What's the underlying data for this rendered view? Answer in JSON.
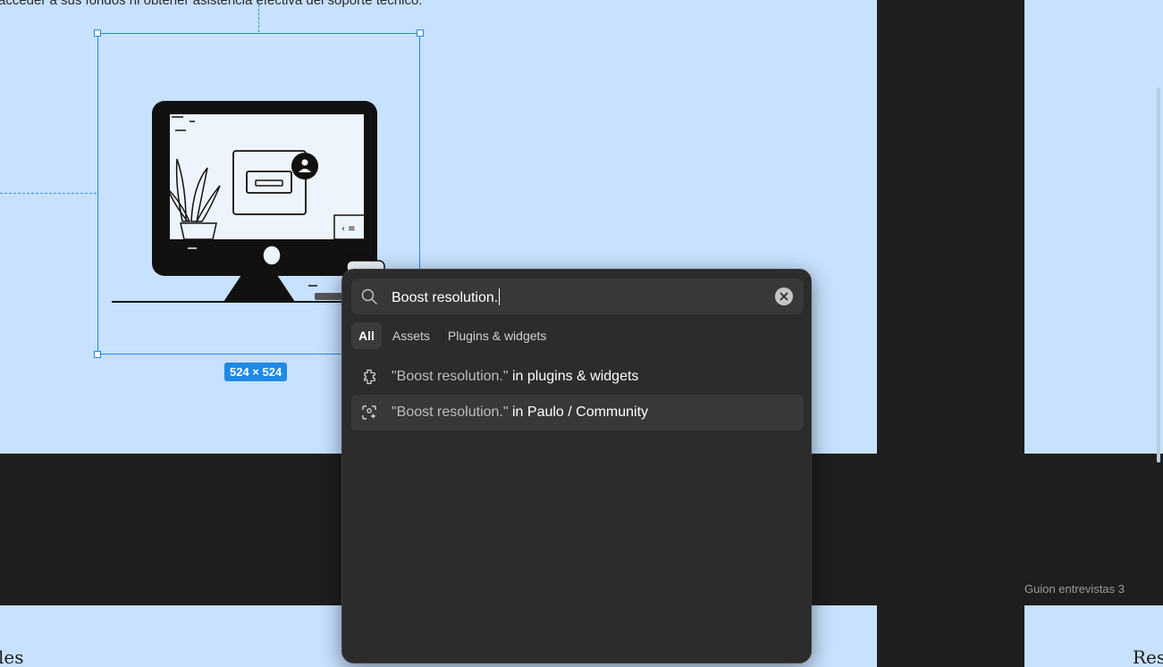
{
  "canvas": {
    "body_text": "acceder a sus fondos ni obtener asistencia efectiva del soporte técnico.",
    "selection_size": "524 × 524",
    "frame_label": "Guion entrevistas 3",
    "heading_left": "les",
    "heading_right": "Res"
  },
  "search": {
    "value": "Boost resolution.",
    "icon": "search-icon",
    "clear_icon": "close-icon"
  },
  "tabs": [
    {
      "label": "All",
      "active": true
    },
    {
      "label": "Assets",
      "active": false
    },
    {
      "label": "Plugins & widgets",
      "active": false
    }
  ],
  "results": [
    {
      "query": "\"Boost resolution.\"",
      "scope": " in plugins & widgets",
      "icon": "plugin-icon"
    },
    {
      "query": "\"Boost resolution.\"",
      "scope": " in Paulo / Community",
      "icon": "ai-sparkle-icon"
    }
  ],
  "colors": {
    "canvas_bg": "#1e1e1e",
    "frame_bg": "#c7e1fe",
    "selection": "#1f8ae5",
    "panel_bg": "#2c2c2c"
  }
}
